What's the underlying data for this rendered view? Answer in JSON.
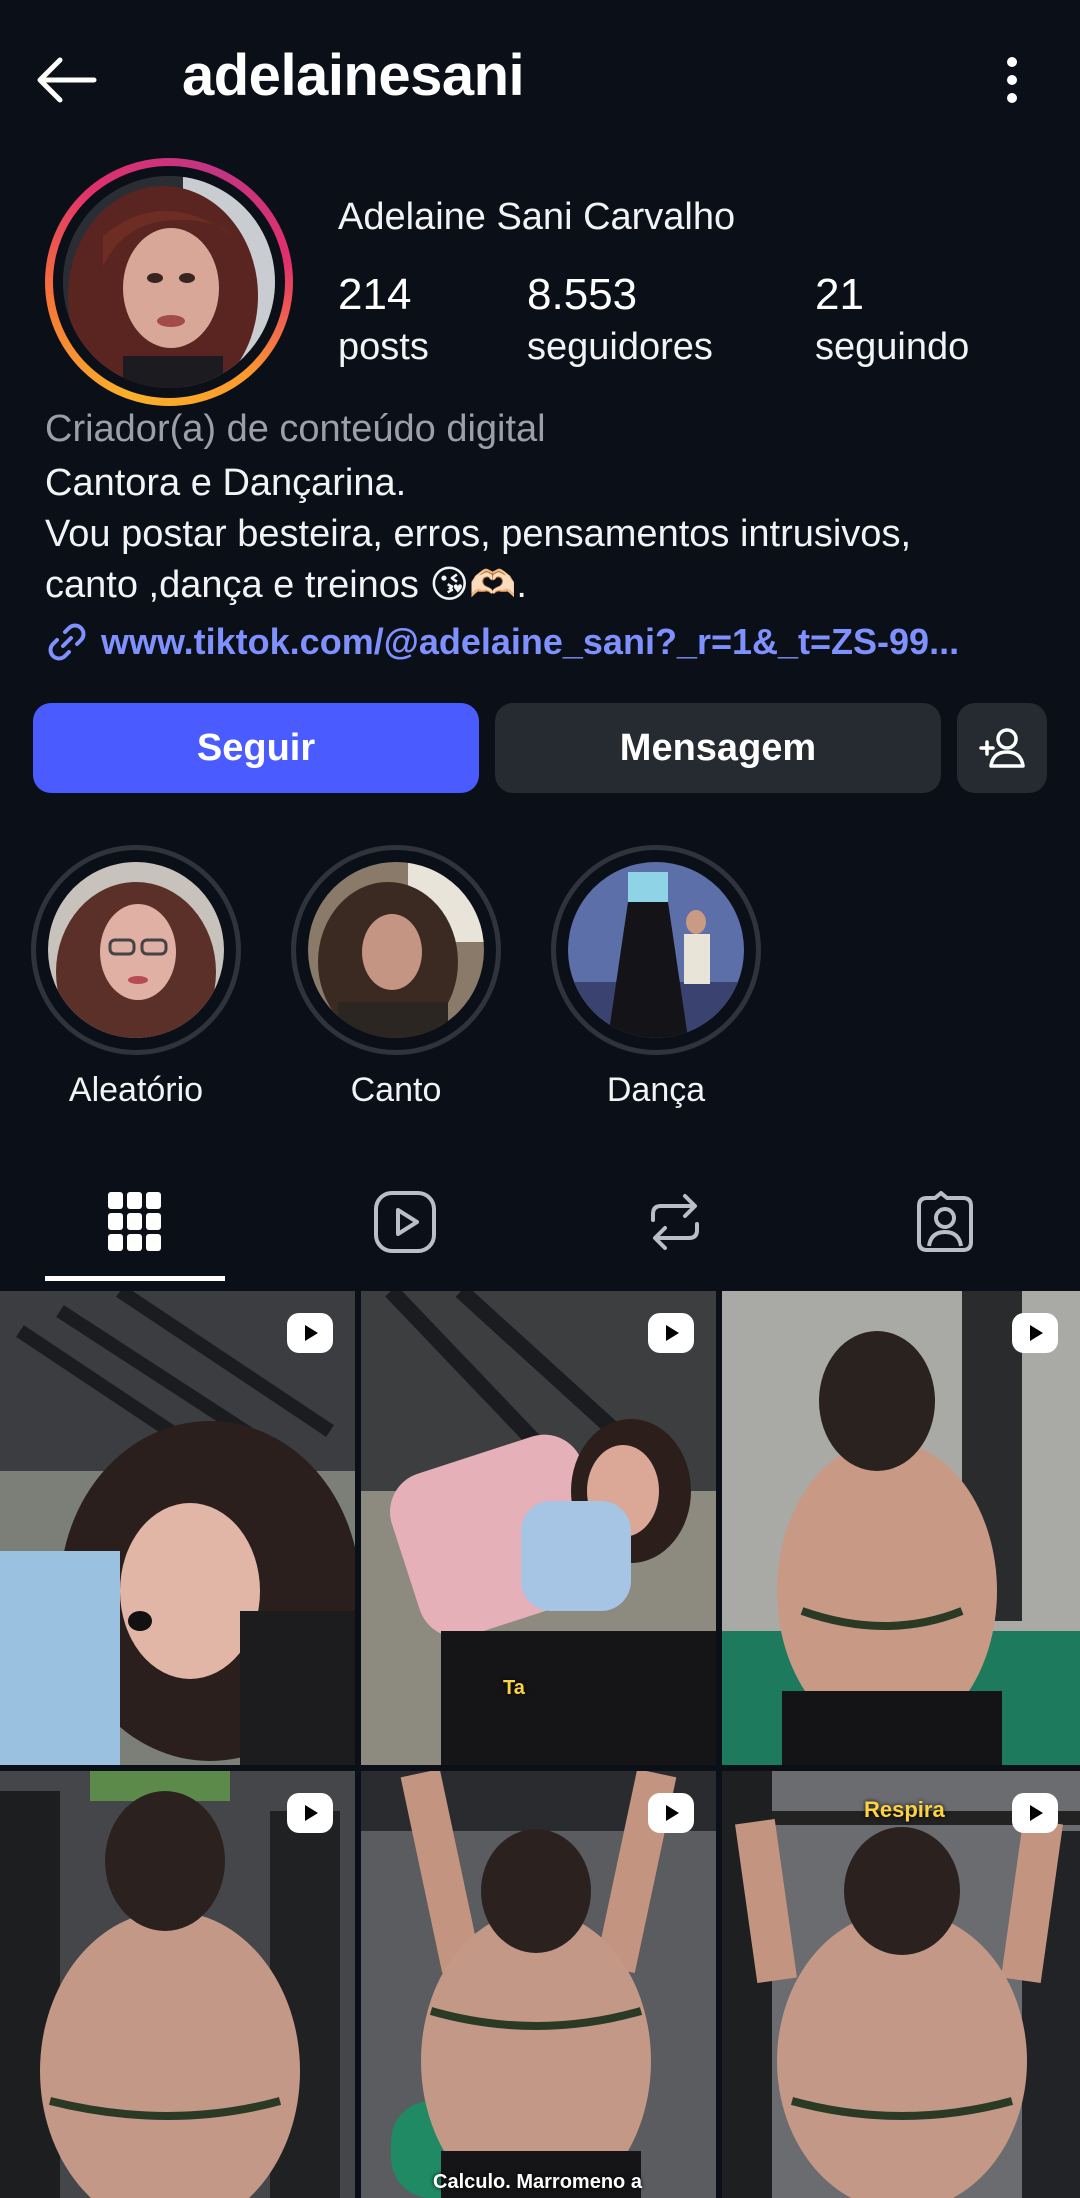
{
  "header": {
    "username": "adelainesani",
    "back_icon": "arrow-left-icon",
    "more_icon": "more-vertical-icon"
  },
  "profile": {
    "full_name": "Adelaine Sani Carvalho",
    "stats": [
      {
        "value": "214",
        "label": "posts"
      },
      {
        "value": "8.553",
        "label": "seguidores"
      },
      {
        "value": "21",
        "label": "seguindo"
      }
    ],
    "category": "Criador(a) de conteúdo digital",
    "bio_lines": [
      "Cantora e Dançarina.",
      "Vou postar besteira, erros, pensamentos intrusivos,",
      "canto ,dança e treinos 😘🫶🏻."
    ],
    "link": "www.tiktok.com/@adelaine_sani?_r=1&_t=ZS-99..."
  },
  "actions": {
    "follow_label": "Seguir",
    "message_label": "Mensagem",
    "add_user_icon": "person-add-icon"
  },
  "highlights": [
    {
      "label": "Aleatório"
    },
    {
      "label": "Canto"
    },
    {
      "label": "Dança"
    }
  ],
  "tabs": [
    {
      "icon": "grid-icon",
      "active": true
    },
    {
      "icon": "reels-icon",
      "active": false
    },
    {
      "icon": "repost-icon",
      "active": false
    },
    {
      "icon": "tagged-icon",
      "active": false
    }
  ],
  "posts": [
    {
      "type": "reel",
      "overlay": ""
    },
    {
      "type": "reel",
      "overlay": "Ta"
    },
    {
      "type": "reel",
      "overlay": ""
    },
    {
      "type": "reel",
      "overlay": ""
    },
    {
      "type": "reel",
      "overlay": "Calculo. Marromeno a"
    },
    {
      "type": "reel",
      "overlay": "Respira"
    }
  ],
  "colors": {
    "background": "#0b0f17",
    "primary_button": "#4a5cff",
    "secondary_button": "#262a31",
    "link": "#7f91ff",
    "muted_text": "#9aa0aa"
  }
}
